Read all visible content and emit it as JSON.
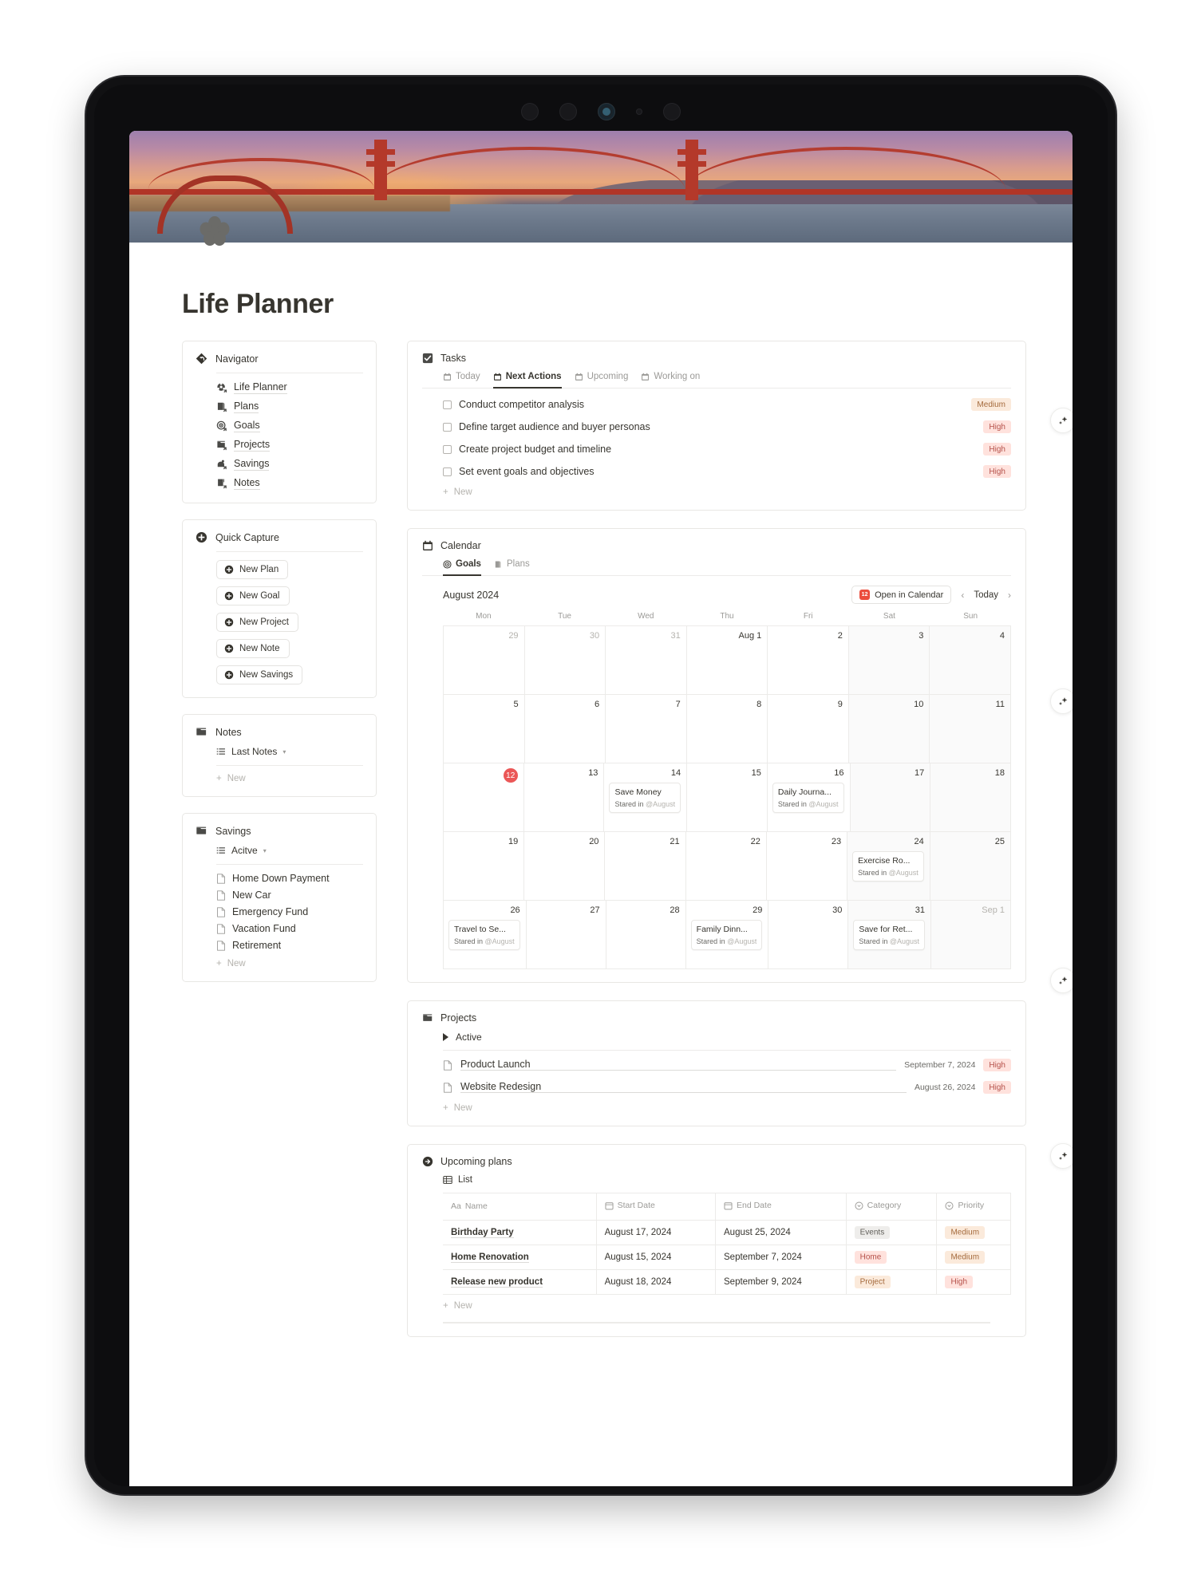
{
  "page": {
    "title": "Life Planner",
    "icon": "flower-cluster-icon",
    "cover": "golden-gate-bridge-sunset-cover"
  },
  "navigator": {
    "title": "Navigator",
    "icon": "navigator-diamond-icon",
    "items": [
      {
        "label": "Life Planner",
        "icon": "life-planner-icon"
      },
      {
        "label": "Plans",
        "icon": "plans-icon"
      },
      {
        "label": "Goals",
        "icon": "goals-target-icon"
      },
      {
        "label": "Projects",
        "icon": "projects-folder-icon"
      },
      {
        "label": "Savings",
        "icon": "savings-icon"
      },
      {
        "label": "Notes",
        "icon": "notes-icon"
      }
    ]
  },
  "quick_capture": {
    "title": "Quick Capture",
    "icon": "plus-circle-icon",
    "buttons": [
      {
        "label": "New Plan"
      },
      {
        "label": "New Goal"
      },
      {
        "label": "New Project"
      },
      {
        "label": "New Note"
      },
      {
        "label": "New Savings"
      }
    ]
  },
  "notes": {
    "title": "Notes",
    "icon": "folder-icon",
    "view": "Last Notes",
    "new_label": "New"
  },
  "savings": {
    "title": "Savings",
    "icon": "folder-icon",
    "view": "Acitve",
    "items": [
      {
        "label": "Home Down Payment"
      },
      {
        "label": "New Car"
      },
      {
        "label": "Emergency Fund"
      },
      {
        "label": "Vacation Fund"
      },
      {
        "label": "Retirement"
      }
    ],
    "new_label": "New"
  },
  "tasks": {
    "title": "Tasks",
    "icon": "checkbox-checked-icon",
    "tabs": [
      {
        "label": "Today",
        "active": false
      },
      {
        "label": "Next Actions",
        "active": true
      },
      {
        "label": "Upcoming",
        "active": false
      },
      {
        "label": "Working on",
        "active": false
      }
    ],
    "items": [
      {
        "label": "Conduct competitor analysis",
        "priority": "Medium",
        "priority_class": "p-medium"
      },
      {
        "label": "Define target audience and buyer personas",
        "priority": "High",
        "priority_class": "p-high"
      },
      {
        "label": "Create project budget and timeline",
        "priority": "High",
        "priority_class": "p-high"
      },
      {
        "label": "Set event goals and objectives",
        "priority": "High",
        "priority_class": "p-high"
      }
    ],
    "new_label": "New"
  },
  "calendar": {
    "title": "Calendar",
    "icon": "calendar-icon",
    "tabs": [
      {
        "label": "Goals",
        "active": true
      },
      {
        "label": "Plans",
        "active": false
      }
    ],
    "month": "August 2024",
    "open_label": "Open in Calendar",
    "today_label": "Today",
    "prev_label": "‹",
    "next_label": "›",
    "dow": [
      "Mon",
      "Tue",
      "Wed",
      "Thu",
      "Fri",
      "Sat",
      "Sun"
    ],
    "event_sub_prefix": "Stared in",
    "event_sub_ref": "@August",
    "weeks": [
      [
        {
          "num": "29",
          "muted": true
        },
        {
          "num": "30",
          "muted": true
        },
        {
          "num": "31",
          "muted": true
        },
        {
          "num": "Aug 1"
        },
        {
          "num": "2"
        },
        {
          "num": "3",
          "weekend": true
        },
        {
          "num": "4",
          "weekend": true
        }
      ],
      [
        {
          "num": "5"
        },
        {
          "num": "6"
        },
        {
          "num": "7"
        },
        {
          "num": "8"
        },
        {
          "num": "9"
        },
        {
          "num": "10",
          "weekend": true
        },
        {
          "num": "11",
          "weekend": true
        }
      ],
      [
        {
          "num": "12",
          "today": true
        },
        {
          "num": "13"
        },
        {
          "num": "14",
          "event": "Save Money"
        },
        {
          "num": "15"
        },
        {
          "num": "16",
          "event": "Daily Journa..."
        },
        {
          "num": "17",
          "weekend": true
        },
        {
          "num": "18",
          "weekend": true
        }
      ],
      [
        {
          "num": "19"
        },
        {
          "num": "20"
        },
        {
          "num": "21"
        },
        {
          "num": "22"
        },
        {
          "num": "23"
        },
        {
          "num": "24",
          "weekend": true,
          "event": "Exercise Ro..."
        },
        {
          "num": "25",
          "weekend": true
        }
      ],
      [
        {
          "num": "26",
          "event": "Travel to Se..."
        },
        {
          "num": "27"
        },
        {
          "num": "28"
        },
        {
          "num": "29",
          "event": "Family Dinn..."
        },
        {
          "num": "30"
        },
        {
          "num": "31",
          "weekend": true,
          "event": "Save for Ret..."
        },
        {
          "num": "Sep 1",
          "weekend": true,
          "muted": true
        }
      ]
    ]
  },
  "projects": {
    "title": "Projects",
    "icon": "folder-icon",
    "group": "Active",
    "items": [
      {
        "name": "Product Launch",
        "date": "September 7, 2024",
        "priority": "High",
        "priority_class": "p-high"
      },
      {
        "name": "Website Redesign",
        "date": "August 26, 2024",
        "priority": "High",
        "priority_class": "p-high"
      }
    ],
    "new_label": "New"
  },
  "upcoming_plans": {
    "title": "Upcoming plans",
    "icon": "arrow-right-circle-icon",
    "view": "List",
    "view_icon": "table-icon",
    "columns": [
      {
        "label": "Name",
        "icon": "aa-text-icon"
      },
      {
        "label": "Start Date",
        "icon": "date-icon"
      },
      {
        "label": "End Date",
        "icon": "date-icon"
      },
      {
        "label": "Category",
        "icon": "select-icon"
      },
      {
        "label": "Priority",
        "icon": "select-icon"
      }
    ],
    "rows": [
      {
        "name": "Birthday Party",
        "start": "August 17, 2024",
        "end": "August 25, 2024",
        "category": "Events",
        "category_class": "p-events",
        "priority": "Medium",
        "priority_class": "p-medium"
      },
      {
        "name": "Home Renovation",
        "start": "August 15, 2024",
        "end": "September 7, 2024",
        "category": "Home",
        "category_class": "p-home",
        "priority": "Medium",
        "priority_class": "p-medium"
      },
      {
        "name": "Release new product",
        "start": "August 18, 2024",
        "end": "September 9, 2024",
        "category": "Project",
        "category_class": "p-project",
        "priority": "High",
        "priority_class": "p-high"
      }
    ],
    "new_label": "New"
  },
  "ai_buttons": [
    {
      "icon": "sparkle-icon"
    },
    {
      "icon": "sparkle-icon"
    },
    {
      "icon": "sparkle-icon"
    },
    {
      "icon": "sparkle-icon"
    }
  ],
  "colors": {
    "accent_red": "#eb5757",
    "text": "#37352f",
    "muted": "#9b9a97",
    "border": "#e8e7e4",
    "high": "#ffe2dd",
    "medium": "#fbeadb"
  }
}
